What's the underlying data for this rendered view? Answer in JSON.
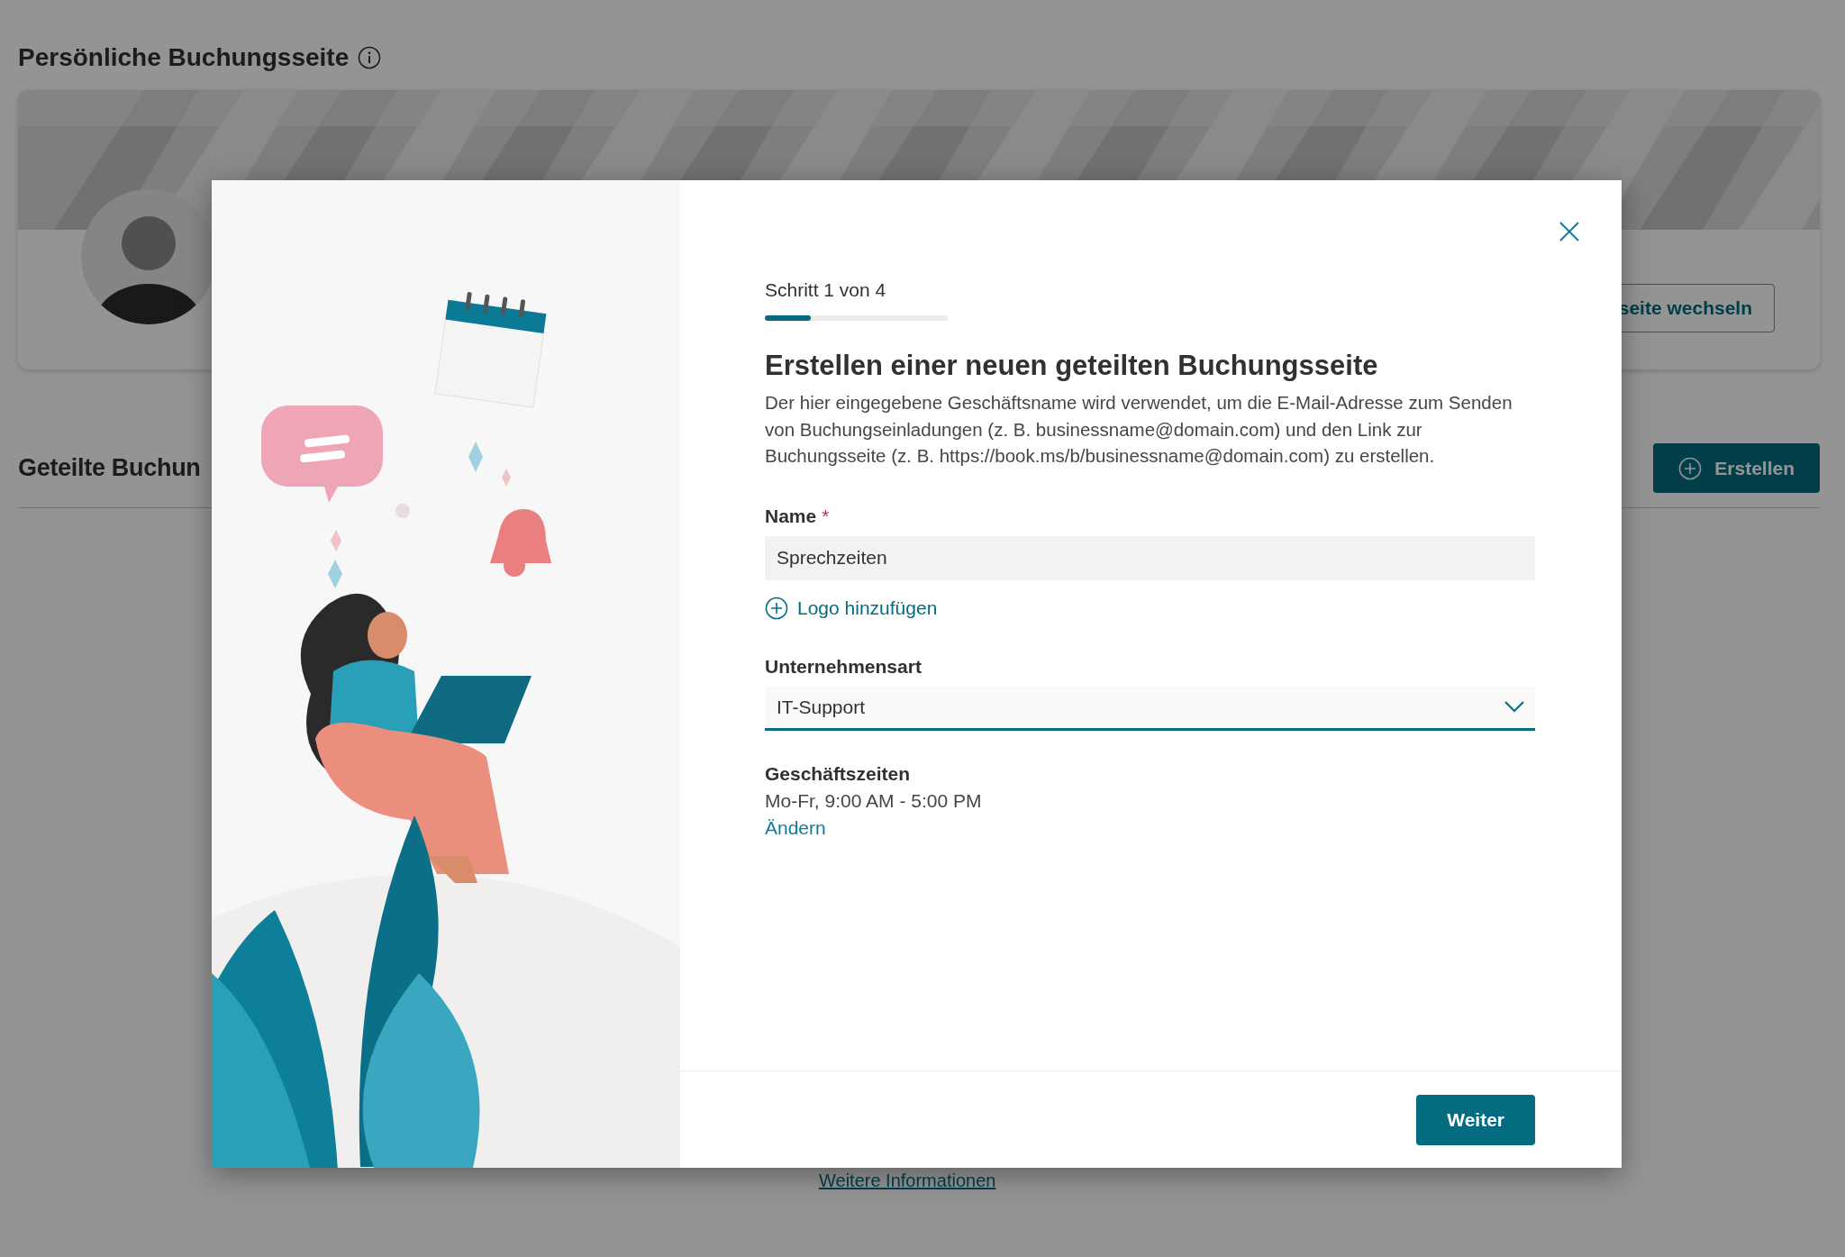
{
  "page": {
    "title": "Persönliche Buchungsseite",
    "personal_card": {
      "switch_button": "seite wechseln"
    },
    "shared_section": {
      "title": "Geteilte Buchun",
      "create_button": "Erstellen"
    },
    "more_info_link": "Weitere Informationen"
  },
  "dialog": {
    "step": "Schritt 1 von 4",
    "progress": {
      "level": 0.25
    },
    "title": "Erstellen einer neuen geteilten Buchungsseite",
    "description": "Der hier eingegebene Geschäftsname wird verwendet, um die E-Mail-Adresse zum Senden von Buchungseinladungen (z. B. businessname@domain.com) und den Link zur Buchungsseite (z. B. https://book.ms/b/businessname@domain.com) zu erstellen.",
    "name_field": {
      "label": "Name",
      "required_mark": "*",
      "value": "Sprechzeiten"
    },
    "logo_link": "Logo hinzufügen",
    "business_type_field": {
      "label": "Unternehmensart",
      "value": "IT-Support"
    },
    "hours": {
      "label": "Geschäftszeiten",
      "value": "Mo-Fr, 9:00 AM - 5:00 PM",
      "change_link": "Ändern"
    },
    "next_button": "Weiter"
  }
}
